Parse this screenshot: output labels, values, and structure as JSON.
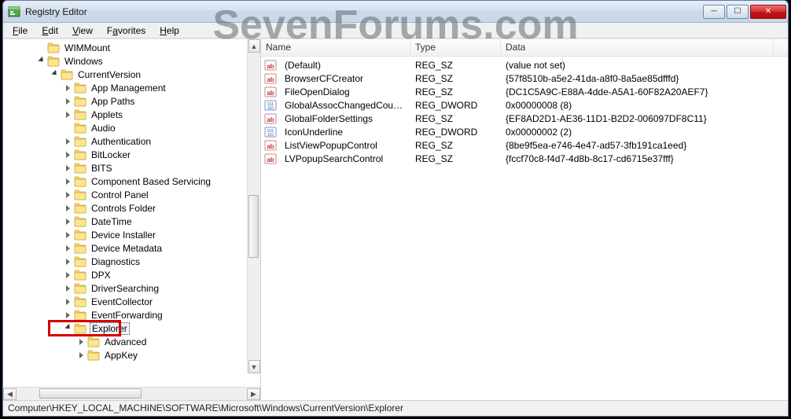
{
  "watermark": "SevenForums.com",
  "window": {
    "title": "Registry Editor"
  },
  "menu": {
    "file": "File",
    "edit": "Edit",
    "view": "View",
    "favorites": "Favorites",
    "help": "Help"
  },
  "tree": {
    "items": [
      {
        "level": 2,
        "expander": "none",
        "label": "WIMMount"
      },
      {
        "level": 2,
        "expander": "expanded",
        "label": "Windows"
      },
      {
        "level": 3,
        "expander": "expanded",
        "label": "CurrentVersion"
      },
      {
        "level": 4,
        "expander": "collapsed",
        "label": "App Management"
      },
      {
        "level": 4,
        "expander": "collapsed",
        "label": "App Paths"
      },
      {
        "level": 4,
        "expander": "collapsed",
        "label": "Applets"
      },
      {
        "level": 4,
        "expander": "none",
        "label": "Audio"
      },
      {
        "level": 4,
        "expander": "collapsed",
        "label": "Authentication"
      },
      {
        "level": 4,
        "expander": "collapsed",
        "label": "BitLocker"
      },
      {
        "level": 4,
        "expander": "collapsed",
        "label": "BITS"
      },
      {
        "level": 4,
        "expander": "collapsed",
        "label": "Component Based Servicing"
      },
      {
        "level": 4,
        "expander": "collapsed",
        "label": "Control Panel"
      },
      {
        "level": 4,
        "expander": "collapsed",
        "label": "Controls Folder"
      },
      {
        "level": 4,
        "expander": "collapsed",
        "label": "DateTime"
      },
      {
        "level": 4,
        "expander": "collapsed",
        "label": "Device Installer"
      },
      {
        "level": 4,
        "expander": "collapsed",
        "label": "Device Metadata"
      },
      {
        "level": 4,
        "expander": "collapsed",
        "label": "Diagnostics"
      },
      {
        "level": 4,
        "expander": "collapsed",
        "label": "DPX"
      },
      {
        "level": 4,
        "expander": "collapsed",
        "label": "DriverSearching"
      },
      {
        "level": 4,
        "expander": "collapsed",
        "label": "EventCollector"
      },
      {
        "level": 4,
        "expander": "collapsed",
        "label": "EventForwarding"
      },
      {
        "level": 4,
        "expander": "expanded",
        "label": "Explorer",
        "selected": true,
        "highlight": true
      },
      {
        "level": 5,
        "expander": "collapsed",
        "label": "Advanced"
      },
      {
        "level": 5,
        "expander": "collapsed",
        "label": "AppKey"
      }
    ]
  },
  "listHeaders": {
    "name": "Name",
    "type": "Type",
    "data": "Data"
  },
  "values": [
    {
      "icon": "string",
      "name": "(Default)",
      "type": "REG_SZ",
      "data": "(value not set)"
    },
    {
      "icon": "string",
      "name": "BrowserCFCreator",
      "type": "REG_SZ",
      "data": "{57f8510b-a5e2-41da-a8f0-8a5ae85dfffd}"
    },
    {
      "icon": "string",
      "name": "FileOpenDialog",
      "type": "REG_SZ",
      "data": "{DC1C5A9C-E88A-4dde-A5A1-60F82A20AEF7}"
    },
    {
      "icon": "binary",
      "name": "GlobalAssocChangedCounter",
      "type": "REG_DWORD",
      "data": "0x00000008 (8)"
    },
    {
      "icon": "string",
      "name": "GlobalFolderSettings",
      "type": "REG_SZ",
      "data": "{EF8AD2D1-AE36-11D1-B2D2-006097DF8C11}"
    },
    {
      "icon": "binary",
      "name": "IconUnderline",
      "type": "REG_DWORD",
      "data": "0x00000002 (2)"
    },
    {
      "icon": "string",
      "name": "ListViewPopupControl",
      "type": "REG_SZ",
      "data": "{8be9f5ea-e746-4e47-ad57-3fb191ca1eed}"
    },
    {
      "icon": "string",
      "name": "LVPopupSearchControl",
      "type": "REG_SZ",
      "data": "{fccf70c8-f4d7-4d8b-8c17-cd6715e37fff}"
    }
  ],
  "statusbar": "Computer\\HKEY_LOCAL_MACHINE\\SOFTWARE\\Microsoft\\Windows\\CurrentVersion\\Explorer"
}
